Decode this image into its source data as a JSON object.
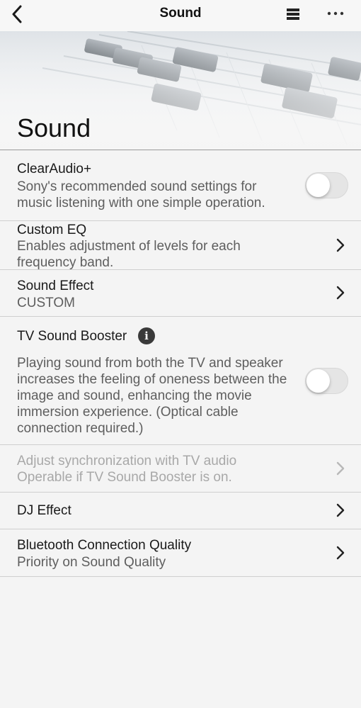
{
  "nav": {
    "title": "Sound",
    "back_icon": "chevron-left-icon",
    "list_icon": "list-icon",
    "more_icon": "more-horizontal-icon"
  },
  "banner": {
    "title": "Sound",
    "image": "mixing-console-image"
  },
  "rows": {
    "clearaudio": {
      "title": "ClearAudio+",
      "desc_line1": "Sony's recommended sound settings for",
      "desc_line2": "music listening with one simple operation.",
      "toggle_on": false
    },
    "custom_eq": {
      "title": "Custom EQ",
      "desc_line1": "Enables adjustment of levels for each",
      "desc_line2": "frequency band."
    },
    "sound_effect": {
      "title": "Sound Effect",
      "value": "CUSTOM"
    },
    "tv_booster": {
      "title": "TV Sound Booster",
      "info_icon": "info-icon",
      "info_glyph": "i",
      "desc_line1": "Playing sound from both the TV and speaker",
      "desc_line2": "increases the feeling of oneness between the",
      "desc_line3": "image and sound, enhancing the movie",
      "desc_line4": "immersion experience. (Optical cable",
      "desc_line5": "connection required.)",
      "toggle_on": false
    },
    "sync": {
      "desc_line1": "Adjust synchronization with TV audio",
      "desc_line2": "Operable if TV Sound Booster is on.",
      "enabled": false
    },
    "dj_effect": {
      "title": "DJ Effect"
    },
    "bluetooth": {
      "title": "Bluetooth Connection Quality",
      "value": "Priority on Sound Quality"
    }
  },
  "colors": {
    "background": "#f4f4f4",
    "divider": "#cfcfcf",
    "disabled_text": "#a8a8a8",
    "toggle_off": "#e5e5e5"
  }
}
